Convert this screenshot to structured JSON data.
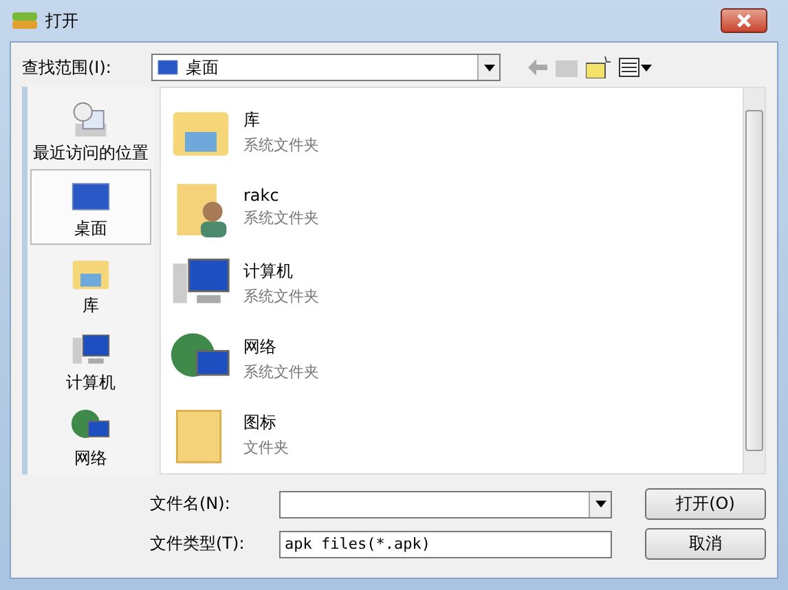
{
  "window": {
    "title": "打开"
  },
  "look_in": {
    "label": "查找范围(I):",
    "value": "桌面"
  },
  "sidebar": {
    "items": [
      {
        "label": "最近访问的位置",
        "kind": "recent",
        "selected": false
      },
      {
        "label": "桌面",
        "kind": "desktop",
        "selected": true
      },
      {
        "label": "库",
        "kind": "library",
        "selected": false
      },
      {
        "label": "计算机",
        "kind": "computer",
        "selected": false
      },
      {
        "label": "网络",
        "kind": "network",
        "selected": false
      }
    ]
  },
  "files": [
    {
      "name": "库",
      "type": "系统文件夹",
      "kind": "library"
    },
    {
      "name": "rakc",
      "type": "系统文件夹",
      "kind": "user"
    },
    {
      "name": "计算机",
      "type": "系统文件夹",
      "kind": "computer"
    },
    {
      "name": "网络",
      "type": "系统文件夹",
      "kind": "network"
    },
    {
      "name": "图标",
      "type": "文件夹",
      "kind": "folder"
    }
  ],
  "file_name": {
    "label": "文件名(N):"
  },
  "file_type": {
    "label": "文件类型(T):",
    "value": "apk files(*.apk)"
  },
  "buttons": [
    "打开(O)",
    "取消"
  ]
}
